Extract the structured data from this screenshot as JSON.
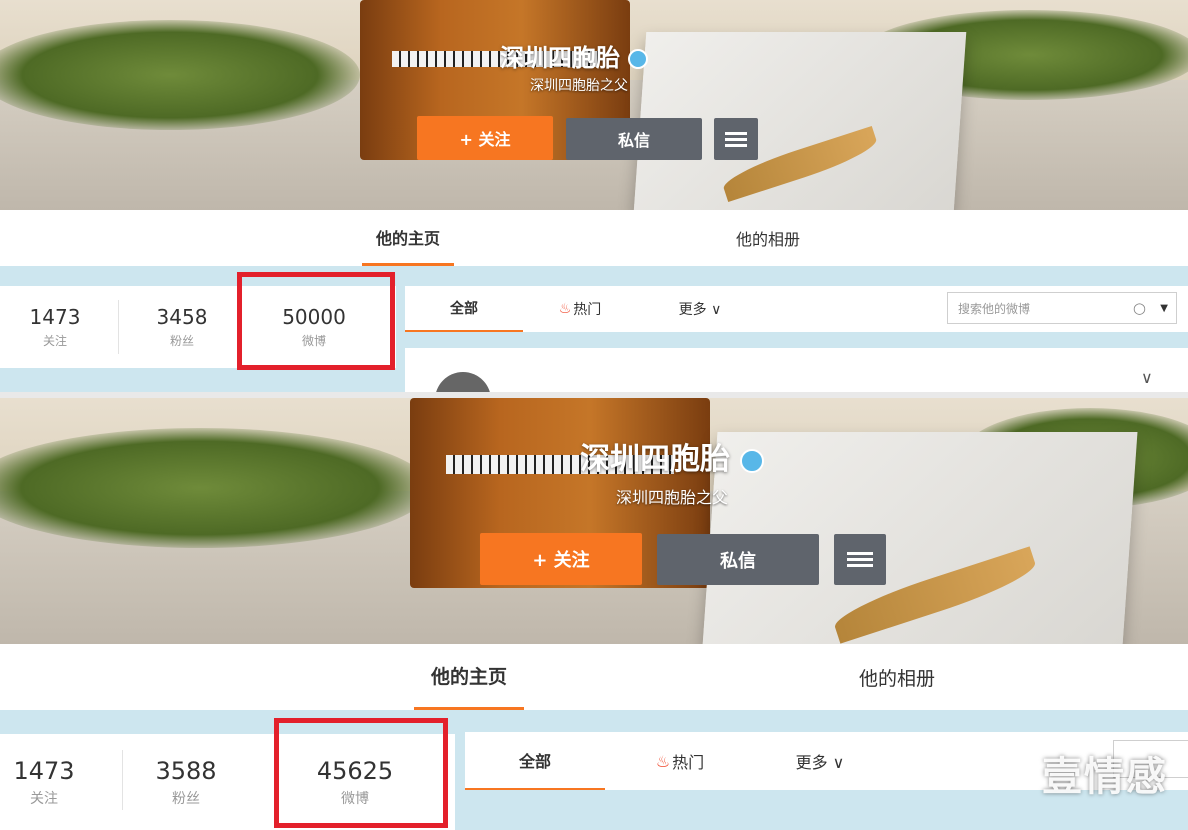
{
  "top": {
    "profile_name": "深圳四胞胎",
    "profile_subtitle": "深圳四胞胎之父",
    "follow_label": "+ 关注",
    "message_label": "私信",
    "tab_home": "他的主页",
    "tab_album": "他的相册",
    "stats": [
      {
        "value": "1473",
        "label": "关注"
      },
      {
        "value": "3458",
        "label": "粉丝"
      },
      {
        "value": "50000",
        "label": "微博"
      }
    ],
    "feed_tab_all": "全部",
    "feed_tab_hot": "热门",
    "feed_tab_more": "更多 ∨",
    "search_placeholder": "搜索他的微博"
  },
  "bottom": {
    "profile_name": "深圳四胞胎",
    "profile_subtitle": "深圳四胞胎之父",
    "follow_label": "+ 关注",
    "message_label": "私信",
    "tab_home": "他的主页",
    "tab_album": "他的相册",
    "stats": [
      {
        "value": "1473",
        "label": "关注"
      },
      {
        "value": "3588",
        "label": "粉丝"
      },
      {
        "value": "45625",
        "label": "微博"
      }
    ],
    "feed_tab_all": "全部",
    "feed_tab_hot": "热门",
    "feed_tab_more": "更多 ∨"
  },
  "watermark": "壹情感",
  "colors": {
    "accent": "#f77621",
    "highlight": "#e3202b",
    "verified": "#58b7e8"
  }
}
